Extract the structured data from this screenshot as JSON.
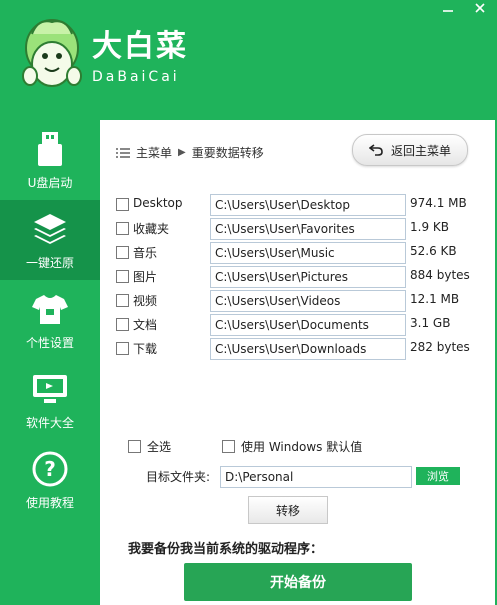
{
  "brand": {
    "name_cn": "大白菜",
    "name_en": "DaBaiCai"
  },
  "sidebar": {
    "items": [
      {
        "label": "U盘启动",
        "icon": "usb-icon"
      },
      {
        "label": "一键还原",
        "icon": "layers-icon"
      },
      {
        "label": "个性设置",
        "icon": "tshirt-icon"
      },
      {
        "label": "软件大全",
        "icon": "monitor-icon"
      },
      {
        "label": "使用教程",
        "icon": "help-icon"
      }
    ],
    "active_index": 1
  },
  "breadcrumb": {
    "root": "主菜单",
    "current": "重要数据转移"
  },
  "back_button": {
    "label": "返回主菜单"
  },
  "rows": [
    {
      "name": "Desktop",
      "path": "C:\\Users\\User\\Desktop",
      "size": "974.1 MB",
      "checked": false
    },
    {
      "name": "收藏夹",
      "path": "C:\\Users\\User\\Favorites",
      "size": "1.9 KB",
      "checked": false
    },
    {
      "name": "音乐",
      "path": "C:\\Users\\User\\Music",
      "size": "52.6 KB",
      "checked": false
    },
    {
      "name": "图片",
      "path": "C:\\Users\\User\\Pictures",
      "size": "884 bytes",
      "checked": false
    },
    {
      "name": "视频",
      "path": "C:\\Users\\User\\Videos",
      "size": "12.1 MB",
      "checked": false
    },
    {
      "name": "文档",
      "path": "C:\\Users\\User\\Documents",
      "size": "3.1 GB",
      "checked": false
    },
    {
      "name": "下载",
      "path": "C:\\Users\\User\\Downloads",
      "size": "282 bytes",
      "checked": false
    }
  ],
  "options": {
    "select_all": {
      "label": "全选",
      "checked": false
    },
    "windows_default": {
      "label": "使用 Windows 默认值",
      "checked": false
    }
  },
  "target": {
    "label": "目标文件夹:",
    "value": "D:\\Personal",
    "browse_label": "浏览"
  },
  "transfer_button": {
    "label": "转移"
  },
  "backup": {
    "title": "我要备份我当前系统的驱动程序：",
    "start_label": "开始备份"
  },
  "colors": {
    "brand_green": "#1fb35b",
    "active_green": "#15934a",
    "button_green": "#27a555"
  }
}
